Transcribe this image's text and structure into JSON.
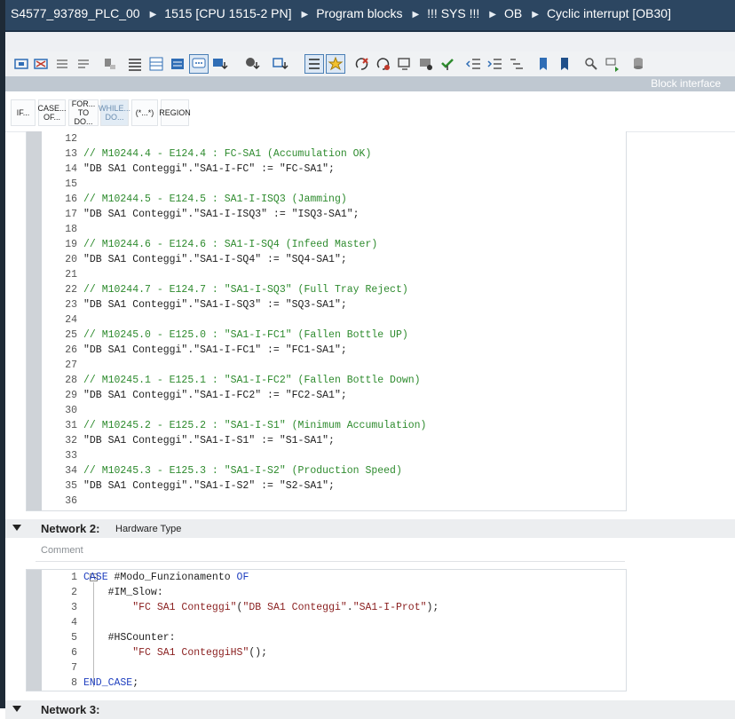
{
  "breadcrumb": [
    "S4577_93789_PLC_00",
    "1515 [CPU 1515-2 PN]",
    "Program blocks",
    "!!! SYS !!!",
    "OB",
    "Cyclic interrupt [OB30]"
  ],
  "block_interface_label": "Block interface",
  "instruction_buttons": [
    {
      "label": "IF..."
    },
    {
      "label": "CASE... OF..."
    },
    {
      "label": "FOR... TO DO..."
    },
    {
      "label": "WHILE... DO..."
    },
    {
      "label": "(*...*)"
    },
    {
      "label": "REGION"
    }
  ],
  "network1_lines": [
    {
      "n": "12",
      "text": ""
    },
    {
      "n": "13",
      "text": "// M10244.4 - E124.4 : FC-SA1 (Accumulation OK)"
    },
    {
      "n": "14",
      "text": "\"DB SA1 Conteggi\".\"SA1-I-FC\" := \"FC-SA1\";"
    },
    {
      "n": "15",
      "text": ""
    },
    {
      "n": "16",
      "text": "// M10244.5 - E124.5 : SA1-I-ISQ3 (Jamming)"
    },
    {
      "n": "17",
      "text": "\"DB SA1 Conteggi\".\"SA1-I-ISQ3\" := \"ISQ3-SA1\";"
    },
    {
      "n": "18",
      "text": ""
    },
    {
      "n": "19",
      "text": "// M10244.6 - E124.6 : SA1-I-SQ4 (Infeed Master)"
    },
    {
      "n": "20",
      "text": "\"DB SA1 Conteggi\".\"SA1-I-SQ4\" := \"SQ4-SA1\";"
    },
    {
      "n": "21",
      "text": ""
    },
    {
      "n": "22",
      "text": "// M10244.7 - E124.7 : \"SA1-I-SQ3\" (Full Tray Reject)"
    },
    {
      "n": "23",
      "text": "\"DB SA1 Conteggi\".\"SA1-I-SQ3\" := \"SQ3-SA1\";"
    },
    {
      "n": "24",
      "text": ""
    },
    {
      "n": "25",
      "text": "// M10245.0 - E125.0 : \"SA1-I-FC1\" (Fallen Bottle UP)"
    },
    {
      "n": "26",
      "text": "\"DB SA1 Conteggi\".\"SA1-I-FC1\" := \"FC1-SA1\";"
    },
    {
      "n": "27",
      "text": ""
    },
    {
      "n": "28",
      "text": "// M10245.1 - E125.1 : \"SA1-I-FC2\" (Fallen Bottle Down)"
    },
    {
      "n": "29",
      "text": "\"DB SA1 Conteggi\".\"SA1-I-FC2\" := \"FC2-SA1\";"
    },
    {
      "n": "30",
      "text": ""
    },
    {
      "n": "31",
      "text": "// M10245.2 - E125.2 : \"SA1-I-S1\" (Minimum Accumulation)"
    },
    {
      "n": "32",
      "text": "\"DB SA1 Conteggi\".\"SA1-I-S1\" := \"S1-SA1\";"
    },
    {
      "n": "33",
      "text": ""
    },
    {
      "n": "34",
      "text": "// M10245.3 - E125.3 : \"SA1-I-S2\" (Production Speed)"
    },
    {
      "n": "35",
      "text": "\"DB SA1 Conteggi\".\"SA1-I-S2\" := \"S2-SA1\";"
    },
    {
      "n": "36",
      "text": ""
    }
  ],
  "network2": {
    "title": "Network 2:",
    "subtitle": "Hardware Type",
    "comment_placeholder": "Comment",
    "lines": [
      {
        "n": "1",
        "text": "CASE #Modo_Funzionamento OF"
      },
      {
        "n": "2",
        "text": "    #IM_Slow:"
      },
      {
        "n": "3",
        "text": "        \"FC SA1 Conteggi\"(\"DB SA1 Conteggi\".\"SA1-I-Prot\");"
      },
      {
        "n": "4",
        "text": ""
      },
      {
        "n": "5",
        "text": "    #HSCounter:"
      },
      {
        "n": "6",
        "text": "        \"FC SA1 ConteggiHS\"();"
      },
      {
        "n": "7",
        "text": ""
      },
      {
        "n": "8",
        "text": "END_CASE;"
      }
    ]
  },
  "network3": {
    "title": "Network 3:"
  },
  "colors": {
    "header": "#2c4661",
    "comment": "#2e8b2e",
    "keyword": "#1f3fbf",
    "string": "#8a1f1f"
  }
}
